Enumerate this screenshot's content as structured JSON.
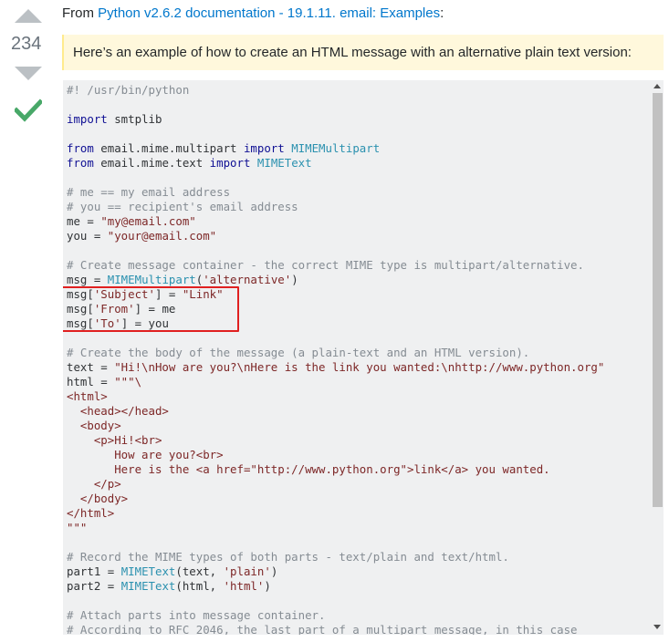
{
  "vote": {
    "count": "234"
  },
  "source": {
    "prefix": "From ",
    "link_text": "Python v2.6.2 documentation - 19.1.11. email: Examples",
    "suffix": ":"
  },
  "quote": "Here’s an example of how to create an HTML message with an alternative plain text version:",
  "code_lines": [
    [
      {
        "t": "#! /usr/bin/python",
        "c": "com"
      }
    ],
    [],
    [
      {
        "t": "import",
        "c": "kw"
      },
      {
        "t": " smtplib"
      }
    ],
    [],
    [
      {
        "t": "from",
        "c": "kw"
      },
      {
        "t": " email.mime.multipart "
      },
      {
        "t": "import",
        "c": "kw"
      },
      {
        "t": " "
      },
      {
        "t": "MIMEMultipart",
        "c": "cls"
      }
    ],
    [
      {
        "t": "from",
        "c": "kw"
      },
      {
        "t": " email.mime.text "
      },
      {
        "t": "import",
        "c": "kw"
      },
      {
        "t": " "
      },
      {
        "t": "MIMEText",
        "c": "cls"
      }
    ],
    [],
    [
      {
        "t": "# me == my email address",
        "c": "com"
      }
    ],
    [
      {
        "t": "# you == recipient's email address",
        "c": "com"
      }
    ],
    [
      {
        "t": "me = "
      },
      {
        "t": "\"my@email.com\"",
        "c": "str"
      }
    ],
    [
      {
        "t": "you = "
      },
      {
        "t": "\"your@email.com\"",
        "c": "str"
      }
    ],
    [],
    [
      {
        "t": "# Create message container - the correct MIME type is multipart/alternative.",
        "c": "com"
      }
    ],
    [
      {
        "t": "msg = "
      },
      {
        "t": "MIMEMultipart",
        "c": "cls"
      },
      {
        "t": "("
      },
      {
        "t": "'alternative'",
        "c": "str"
      },
      {
        "t": ")"
      }
    ],
    [
      {
        "t": "msg["
      },
      {
        "t": "'Subject'",
        "c": "str"
      },
      {
        "t": "] = "
      },
      {
        "t": "\"Link\"",
        "c": "str"
      }
    ],
    [
      {
        "t": "msg["
      },
      {
        "t": "'From'",
        "c": "str"
      },
      {
        "t": "] = me"
      }
    ],
    [
      {
        "t": "msg["
      },
      {
        "t": "'To'",
        "c": "str"
      },
      {
        "t": "] = you"
      }
    ],
    [],
    [
      {
        "t": "# Create the body of the message (a plain-text and an HTML version).",
        "c": "com"
      }
    ],
    [
      {
        "t": "text = "
      },
      {
        "t": "\"Hi!\\nHow are you?\\nHere is the link you wanted:\\nhttp://www.python.org\"",
        "c": "str"
      }
    ],
    [
      {
        "t": "html = "
      },
      {
        "t": "\"\"\"\\",
        "c": "str"
      }
    ],
    [
      {
        "t": "<html>",
        "c": "str"
      }
    ],
    [
      {
        "t": "  <head></head>",
        "c": "str"
      }
    ],
    [
      {
        "t": "  <body>",
        "c": "str"
      }
    ],
    [
      {
        "t": "    <p>Hi!<br>",
        "c": "str"
      }
    ],
    [
      {
        "t": "       How are you?<br>",
        "c": "str"
      }
    ],
    [
      {
        "t": "       Here is the <a href=\"http://www.python.org\">link</a> you wanted.",
        "c": "str"
      }
    ],
    [
      {
        "t": "    </p>",
        "c": "str"
      }
    ],
    [
      {
        "t": "  </body>",
        "c": "str"
      }
    ],
    [
      {
        "t": "</html>",
        "c": "str"
      }
    ],
    [
      {
        "t": "\"\"\"",
        "c": "str"
      }
    ],
    [],
    [
      {
        "t": "# Record the MIME types of both parts - text/plain and text/html.",
        "c": "com"
      }
    ],
    [
      {
        "t": "part1 = "
      },
      {
        "t": "MIMEText",
        "c": "cls"
      },
      {
        "t": "(text, "
      },
      {
        "t": "'plain'",
        "c": "str"
      },
      {
        "t": ")"
      }
    ],
    [
      {
        "t": "part2 = "
      },
      {
        "t": "MIMEText",
        "c": "cls"
      },
      {
        "t": "(html, "
      },
      {
        "t": "'html'",
        "c": "str"
      },
      {
        "t": ")"
      }
    ],
    [],
    [
      {
        "t": "# Attach parts into message container.",
        "c": "com"
      }
    ],
    [
      {
        "t": "# According to RFC 2046, the last part of a multipart message, in this case",
        "c": "com"
      }
    ]
  ],
  "icons": {
    "upvote": "triangle-up-icon",
    "downvote": "triangle-down-icon",
    "accepted": "checkmark-icon"
  },
  "colors": {
    "link": "#0077cc",
    "accepted": "#48a868",
    "highlight_box": "#e02020",
    "quote_bg": "#fff8dc",
    "code_bg": "#eff0f1"
  }
}
